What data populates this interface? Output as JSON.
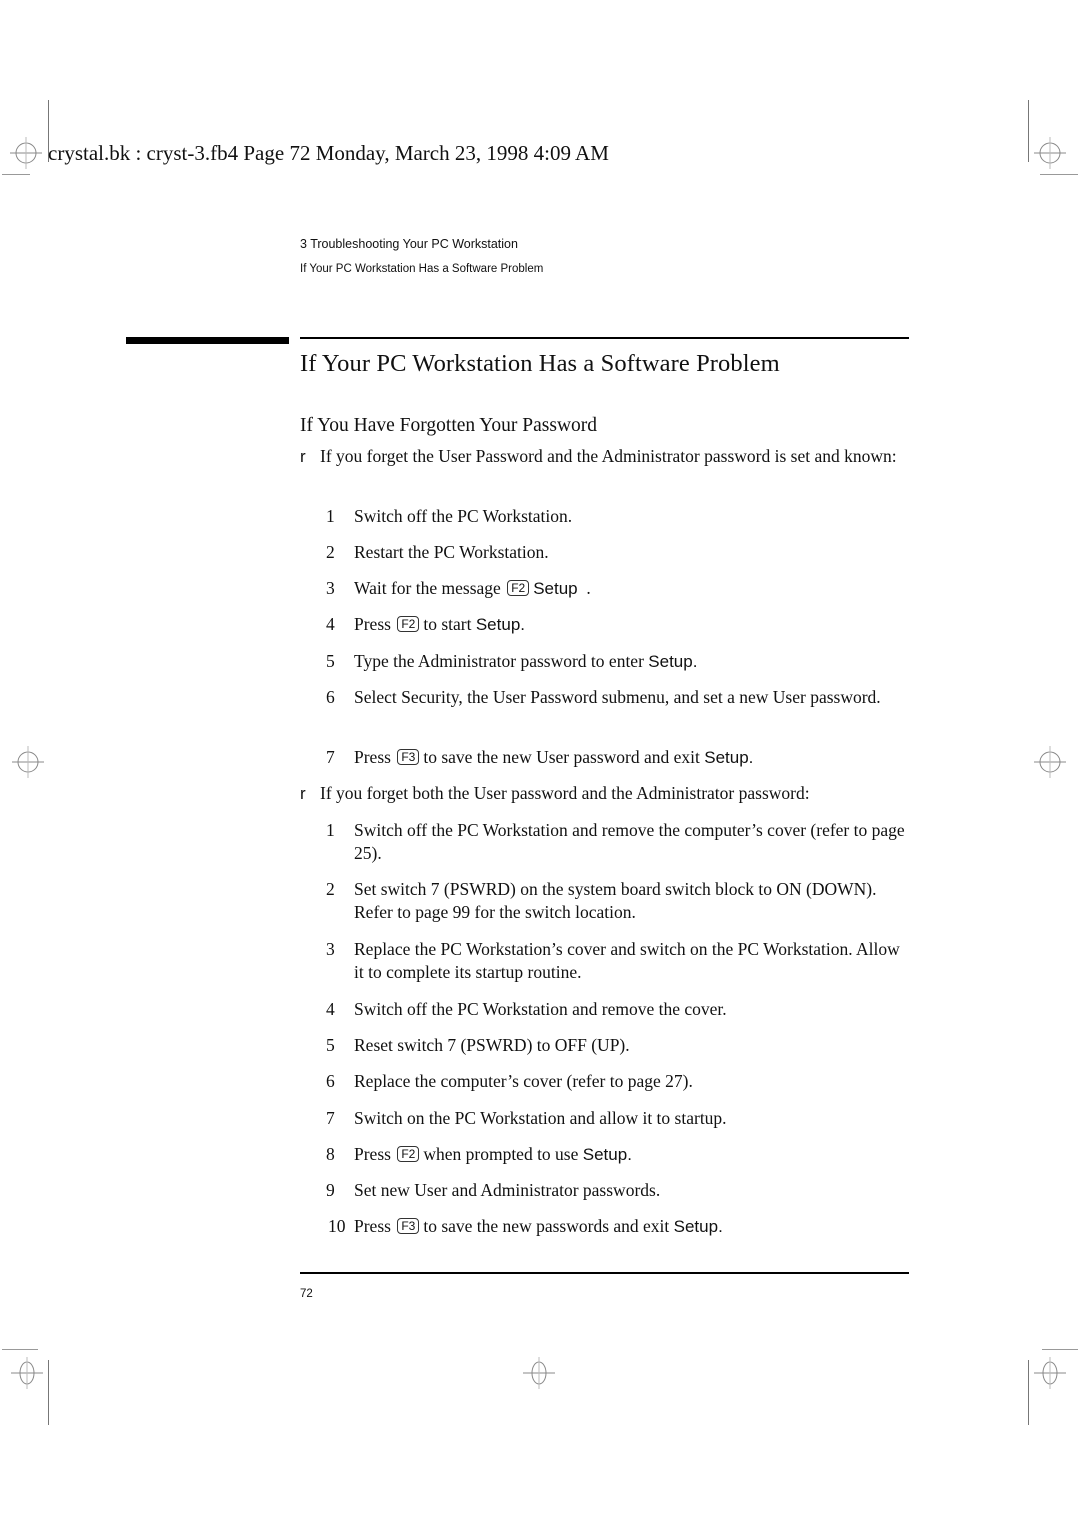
{
  "header_stamp": "crystal.bk : cryst-3.fb4  Page 72  Monday, March 23, 1998  4:09 AM",
  "running_head": {
    "chapter": "3   Troubleshooting Your PC Workstation",
    "section": "If Your PC Workstation Has a Software Problem"
  },
  "section_title": "If Your PC Workstation Has a Software Problem",
  "subsection_title": "If You Have Forgotten Your Password",
  "bullet_glyph": "r",
  "case1": {
    "intro": "If you forget the User Password and the Administrator password is set and known:",
    "steps": [
      {
        "n": "1",
        "text": "Switch off the PC Workstation."
      },
      {
        "n": "2",
        "text": "Restart the PC Workstation."
      },
      {
        "n": "3",
        "pre": "Wait for the message",
        "key": "F2",
        "setup": "Setup",
        "post": "  ."
      },
      {
        "n": "4",
        "pre": "Press",
        "key": "F2",
        "post": "to start",
        "setup": "Setup."
      },
      {
        "n": "5",
        "pre": "Type the Administrator password to enter",
        "setup": "Setup."
      },
      {
        "n": "6",
        "text": "Select Security, the User Password submenu, and set a new User password."
      },
      {
        "n": "7",
        "pre": "Press",
        "key": "F3",
        "post": "to save the new User password and exit",
        "setup": "Setup."
      }
    ]
  },
  "case2": {
    "intro": "If you forget both the User password and the Administrator password:",
    "steps": [
      {
        "n": "1",
        "text": "Switch off the PC Workstation and remove the computer’s cover (refer to page 25)."
      },
      {
        "n": "2",
        "text": "Set switch 7 (PSWRD) on the system board switch block to ON (DOWN). Refer to page 99 for the switch location."
      },
      {
        "n": "3",
        "text": "Replace the PC Workstation’s cover and switch on the PC Workstation. Allow it to complete its startup routine."
      },
      {
        "n": "4",
        "text": "Switch off the PC Workstation and remove the cover."
      },
      {
        "n": "5",
        "text": "Reset switch 7 (PSWRD) to OFF (UP)."
      },
      {
        "n": "6",
        "text": "Replace the computer’s cover (refer to page 27)."
      },
      {
        "n": "7",
        "text": "Switch on the PC Workstation and allow it to startup."
      },
      {
        "n": "8",
        "pre": "Press",
        "key": "F2",
        "post": "when prompted to use",
        "setup": "Setup."
      },
      {
        "n": "9",
        "text": "Set new User and Administrator passwords."
      },
      {
        "n": "10",
        "pre": "Press",
        "key": "F3",
        "post": "to save the new passwords and exit",
        "setup": "Setup."
      }
    ]
  },
  "page_number": "72"
}
